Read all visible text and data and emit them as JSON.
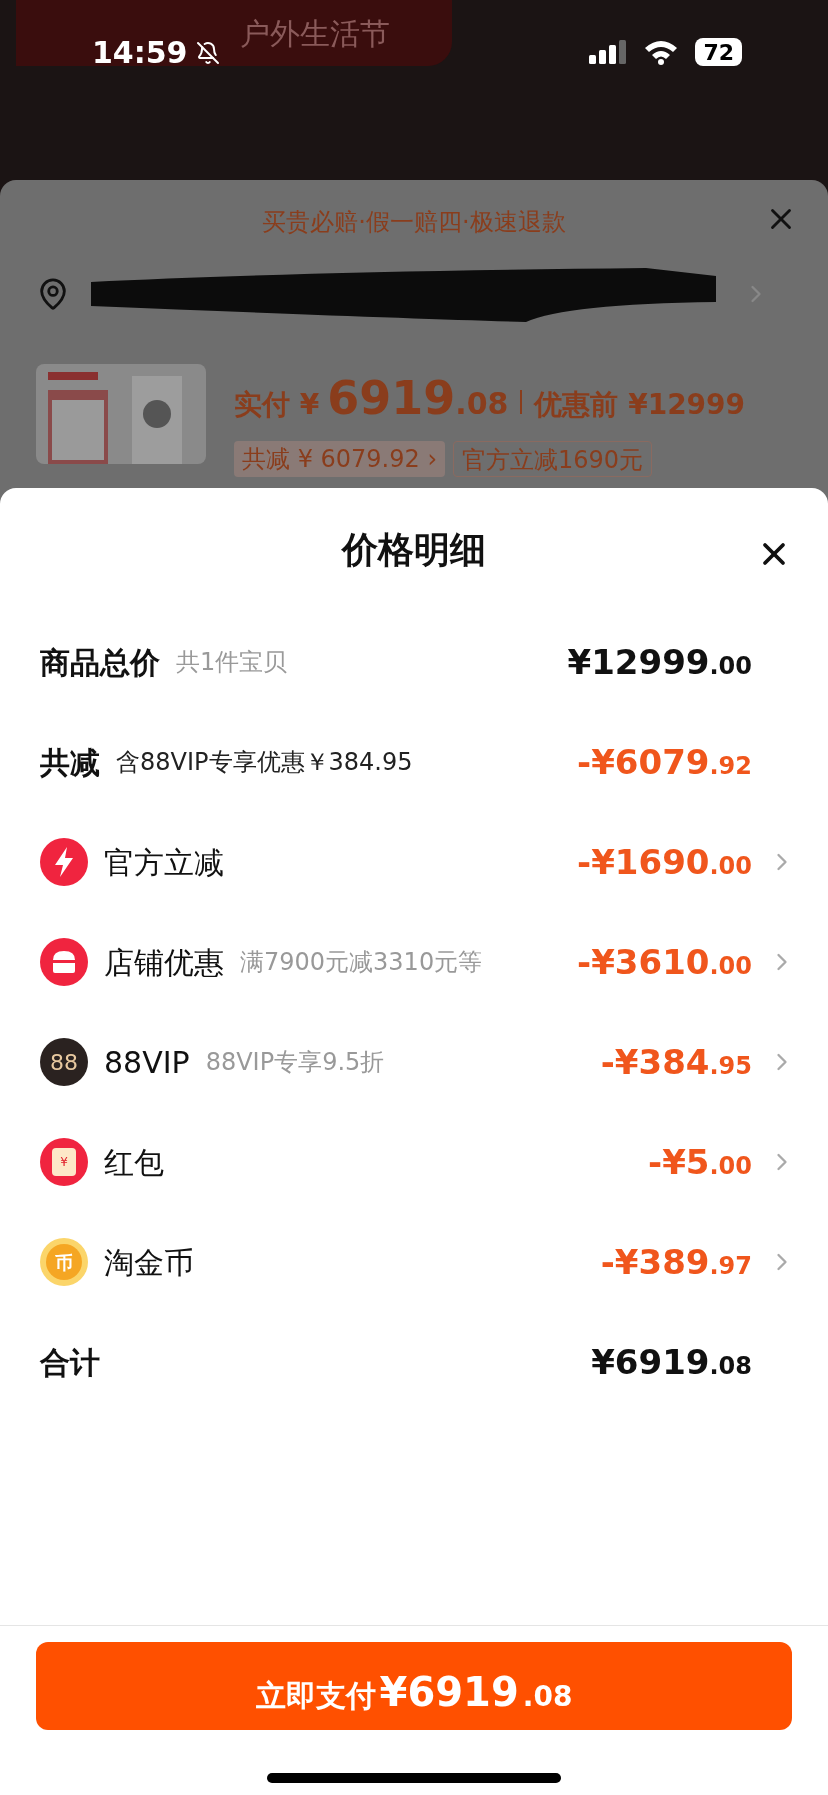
{
  "status_bar": {
    "time": "14:59",
    "battery": "72"
  },
  "background_page": {
    "banner": "户外生活节"
  },
  "order_sheet": {
    "guarantee": "买贵必赔·假一赔四·极速退款",
    "price_label": "实付 ¥",
    "price_main": "6919",
    "price_decimal": ".08",
    "original_price": "优惠前 ¥12999",
    "tags": [
      {
        "text": "共减 ¥ 6079.92 ›",
        "kind": "filled"
      },
      {
        "text": "官方立减1690元",
        "kind": "outline"
      }
    ]
  },
  "price_detail": {
    "title": "价格明细",
    "rows": [
      {
        "kind": "plain",
        "label": "商品总价",
        "note": "共1件宝贝",
        "amount_main": "¥12999",
        "amount_decimal": ".00",
        "discount": false,
        "has_arrow": false
      },
      {
        "kind": "plain",
        "label": "共减",
        "note": "含88VIP专享优惠￥384.95",
        "amount_main": "-¥6079",
        "amount_decimal": ".92",
        "discount": true,
        "has_arrow": false
      },
      {
        "kind": "bolt",
        "label": "官方立减",
        "amount_main": "-¥1690",
        "amount_decimal": ".00",
        "discount": true,
        "has_arrow": true
      },
      {
        "kind": "shop",
        "label": "店铺优惠",
        "note": "满7900元减3310元等",
        "amount_main": "-¥3610",
        "amount_decimal": ".00",
        "discount": true,
        "has_arrow": true
      },
      {
        "kind": "vip",
        "icon_text": "88",
        "label": "88VIP",
        "note": "88VIP专享9.5折",
        "amount_main": "-¥384",
        "amount_decimal": ".95",
        "discount": true,
        "has_arrow": true
      },
      {
        "kind": "packet",
        "icon_text": "¥",
        "label": "红包",
        "amount_main": "-¥5",
        "amount_decimal": ".00",
        "discount": true,
        "has_arrow": true
      },
      {
        "kind": "coin",
        "icon_text": "币",
        "label": "淘金币",
        "amount_main": "-¥389",
        "amount_decimal": ".97",
        "discount": true,
        "has_arrow": true
      },
      {
        "kind": "plain",
        "label": "合计",
        "amount_main": "¥6919",
        "amount_decimal": ".08",
        "discount": false,
        "has_arrow": false
      }
    ],
    "pay_button": {
      "label": "立即支付",
      "amount_main": "¥6919",
      "amount_decimal": ".08"
    }
  }
}
